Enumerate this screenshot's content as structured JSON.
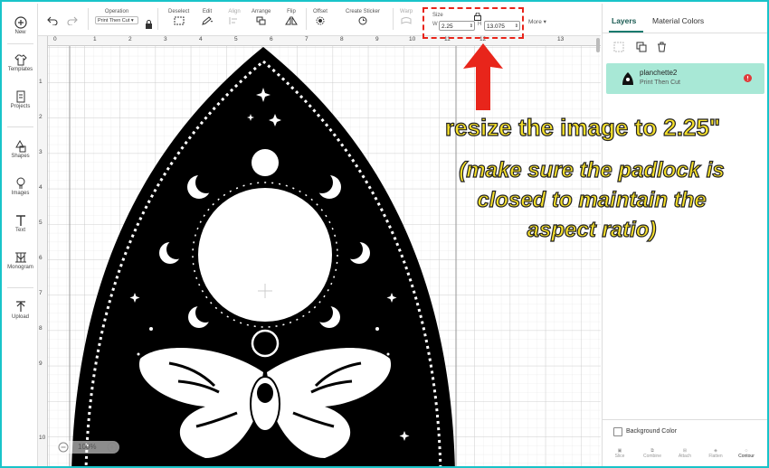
{
  "sidebar": {
    "items": [
      {
        "label": "New",
        "icon": "plus-circle-icon"
      },
      {
        "label": "Templates",
        "icon": "shirt-icon"
      },
      {
        "label": "Projects",
        "icon": "document-icon"
      },
      {
        "label": "Shapes",
        "icon": "shapes-icon"
      },
      {
        "label": "Images",
        "icon": "bulb-icon"
      },
      {
        "label": "Text",
        "icon": "text-icon"
      },
      {
        "label": "Monogram",
        "icon": "monogram-icon"
      },
      {
        "label": "Upload",
        "icon": "upload-icon"
      }
    ]
  },
  "toolbar": {
    "undo_icon": "undo-icon",
    "redo_icon": "redo-icon",
    "operation_label": "Operation",
    "operation_value": "Print Then Cut",
    "deselect_label": "Deselect",
    "edit_label": "Edit",
    "align_label": "Align",
    "arrange_label": "Arrange",
    "flip_label": "Flip",
    "offset_label": "Offset",
    "create_sticker_label": "Create Sticker",
    "warp_label": "Warp",
    "size_label": "Size",
    "width_label": "W",
    "width_value": "2.25",
    "height_label": "H",
    "height_value": "13.075",
    "more_label": "More"
  },
  "right_panel": {
    "tabs": [
      {
        "label": "Layers"
      },
      {
        "label": "Material Colors"
      }
    ],
    "layer": {
      "name": "planchette2",
      "subtitle": "Print Then Cut"
    },
    "background_color_label": "Background Color",
    "bottom_tools": [
      "Slice",
      "Combine",
      "Attach",
      "Flatten",
      "Contour"
    ]
  },
  "canvas": {
    "ruler_top": [
      "0",
      "1",
      "2",
      "3",
      "4",
      "5",
      "6",
      "7",
      "8",
      "9",
      "10",
      "11",
      "12",
      "13"
    ],
    "ruler_left": [
      "1",
      "2",
      "3",
      "4",
      "5",
      "6",
      "7",
      "8",
      "9",
      "10"
    ],
    "zoom_value": "100%"
  },
  "annotation": {
    "line1": "resize the image to 2.25\"",
    "line2": "(make sure the padlock is closed to maintain the aspect ratio)",
    "highlight_color": "#e8251b",
    "text_color": "#f7e12a"
  },
  "colors": {
    "frame_border": "#19c4c9",
    "layer_highlight": "#a8e8d6",
    "tab_accent": "#1a7a6e",
    "warning_badge": "#e03a3a"
  }
}
